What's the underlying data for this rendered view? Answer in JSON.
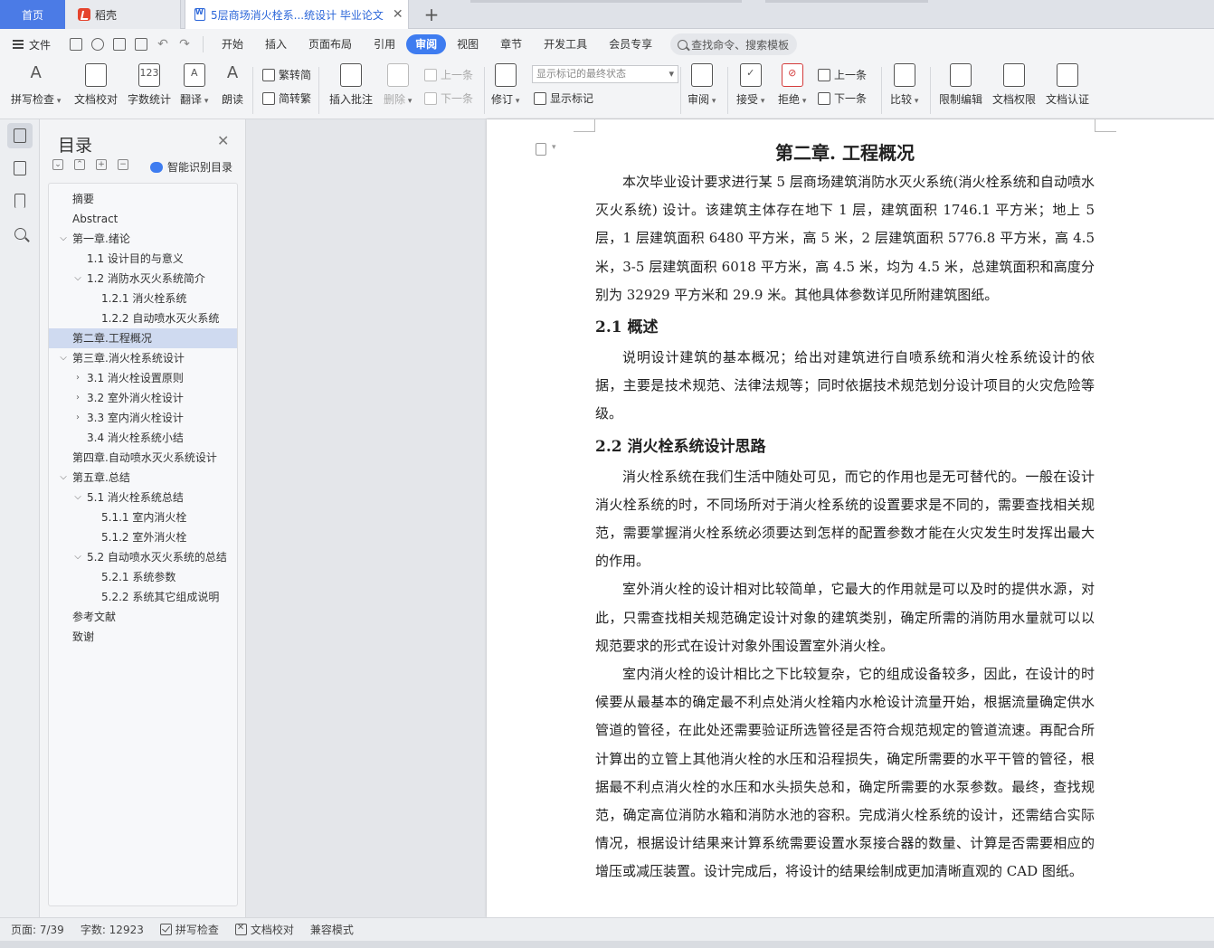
{
  "tabs": {
    "home": "首页",
    "daoke": "稻壳",
    "document": "5层商场消火栓系...统设计 毕业论文",
    "close_glyph": "✕",
    "new_glyph": "+"
  },
  "menu": {
    "file": "文件",
    "items": [
      "开始",
      "插入",
      "页面布局",
      "引用",
      "审阅",
      "视图",
      "章节",
      "开发工具",
      "会员专享"
    ],
    "active": "审阅",
    "search_placeholder": "查找命令、搜索模板"
  },
  "ribbon": {
    "spell_check": "拼写检查",
    "doc_proofread": "文档校对",
    "word_count": "字数统计",
    "word_count_glyph": "123",
    "translate": "翻译",
    "read_aloud": "朗读",
    "trad_to_simp": "繁转简",
    "simp_to_trad": "简转繁",
    "insert_comment": "插入批注",
    "delete": "删除",
    "prev_comment": "上一条",
    "next_comment": "下一条",
    "track_changes": "修订",
    "markup_mode": "显示标记的最终状态",
    "show_markup": "显示标记",
    "review": "审阅",
    "accept": "接受",
    "reject": "拒绝",
    "prev_change": "上一条",
    "next_change": "下一条",
    "compare": "比较",
    "restrict_edit": "限制编辑",
    "doc_permission": "文档权限",
    "doc_certify": "文档认证"
  },
  "toc": {
    "title": "目录",
    "smart_identify": "智能识别目录",
    "items": [
      {
        "label": "摘要",
        "level": 1,
        "chevron": ""
      },
      {
        "label": "Abstract",
        "level": 1,
        "chevron": ""
      },
      {
        "label": "第一章.绪论",
        "level": 1,
        "chevron": "⌵"
      },
      {
        "label": "1.1 设计目的与意义",
        "level": 2,
        "chevron": ""
      },
      {
        "label": "1.2 消防水灭火系统简介",
        "level": 2,
        "chevron": "⌵"
      },
      {
        "label": "1.2.1 消火栓系统",
        "level": 3,
        "chevron": ""
      },
      {
        "label": "1.2.2 自动喷水灭火系统",
        "level": 3,
        "chevron": ""
      },
      {
        "label": "第二章.工程概况",
        "level": 1,
        "chevron": "",
        "selected": true
      },
      {
        "label": "第三章.消火栓系统设计",
        "level": 1,
        "chevron": "⌵"
      },
      {
        "label": "3.1 消火栓设置原则",
        "level": 2,
        "chevron": "›"
      },
      {
        "label": "3.2 室外消火栓设计",
        "level": 2,
        "chevron": "›"
      },
      {
        "label": "3.3 室内消火栓设计",
        "level": 2,
        "chevron": "›"
      },
      {
        "label": "3.4 消火栓系统小结",
        "level": 2,
        "chevron": ""
      },
      {
        "label": "第四章.自动喷水灭火系统设计",
        "level": 1,
        "chevron": ""
      },
      {
        "label": "第五章.总结",
        "level": 1,
        "chevron": "⌵"
      },
      {
        "label": "5.1 消火栓系统总结",
        "level": 2,
        "chevron": "⌵"
      },
      {
        "label": "5.1.1 室内消火栓",
        "level": 3,
        "chevron": ""
      },
      {
        "label": "5.1.2 室外消火栓",
        "level": 3,
        "chevron": ""
      },
      {
        "label": "5.2 自动喷水灭火系统的总结",
        "level": 2,
        "chevron": "⌵"
      },
      {
        "label": "5.2.1 系统参数",
        "level": 3,
        "chevron": ""
      },
      {
        "label": "5.2.2 系统其它组成说明",
        "level": 3,
        "chevron": ""
      },
      {
        "label": "参考文献",
        "level": 1,
        "chevron": ""
      },
      {
        "label": "致谢",
        "level": 1,
        "chevron": ""
      }
    ]
  },
  "document": {
    "chapter_title": "第二章. 工程概况",
    "intro": "本次毕业设计要求进行某 5 层商场建筑消防水灭火系统(消火栓系统和自动喷水灭火系统) 设计。该建筑主体存在地下 1 层，建筑面积 1746.1 平方米；地上 5 层，1 层建筑面积 6480 平方米，高 5 米，2 层建筑面积 5776.8 平方米，高 4.5 米，3-5 层建筑面积 6018 平方米，高 4.5 米，均为 4.5 米，总建筑面积和高度分别为 32929 平方米和 29.9 米。其他具体参数详见所附建筑图纸。",
    "s21_title": "2.1 概述",
    "s21_p1": "说明设计建筑的基本概况；给出对建筑进行自喷系统和消火栓系统设计的依据，主要是技术规范、法律法规等；同时依据技术规范划分设计项目的火灾危险等级。",
    "s22_title": "2.2 消火栓系统设计思路",
    "s22_p1": "消火栓系统在我们生活中随处可见，而它的作用也是无可替代的。一般在设计消火栓系统的时，不同场所对于消火栓系统的设置要求是不同的，需要查找相关规范，需要掌握消火栓系统必须要达到怎样的配置参数才能在火灾发生时发挥出最大的作用。",
    "s22_p2": "室外消火栓的设计相对比较简单，它最大的作用就是可以及时的提供水源，对此，只需查找相关规范确定设计对象的建筑类别，确定所需的消防用水量就可以以规范要求的形式在设计对象外围设置室外消火栓。",
    "s22_p3": "室内消火栓的设计相比之下比较复杂，它的组成设备较多，因此，在设计的时候要从最基本的确定最不利点处消火栓箱内水枪设计流量开始，根据流量确定供水管道的管径，在此处还需要验证所选管径是否符合规范规定的管道流速。再配合所计算出的立管上其他消火栓的水压和沿程损失，确定所需要的水平干管的管径，根据最不利点消火栓的水压和水头损失总和，确定所需要的水泵参数。最终，查找规范，确定高位消防水箱和消防水池的容积。完成消火栓系统的设计，还需结合实际情况，根据设计结果来计算系统需要设置水泵接合器的数量、计算是否需要相应的增压或减压装置。设计完成后，将设计的结果绘制成更加清晰直观的 CAD 图纸。"
  },
  "status": {
    "page": "页面: 7/39",
    "words": "字数: 12923",
    "spell_check": "拼写检查",
    "doc_proofread": "文档校对",
    "compat_mode": "兼容模式"
  },
  "colors": {
    "accent": "#3e7cf0",
    "home_tab": "#4b7be6",
    "toc_selected": "#cfdaf0"
  }
}
